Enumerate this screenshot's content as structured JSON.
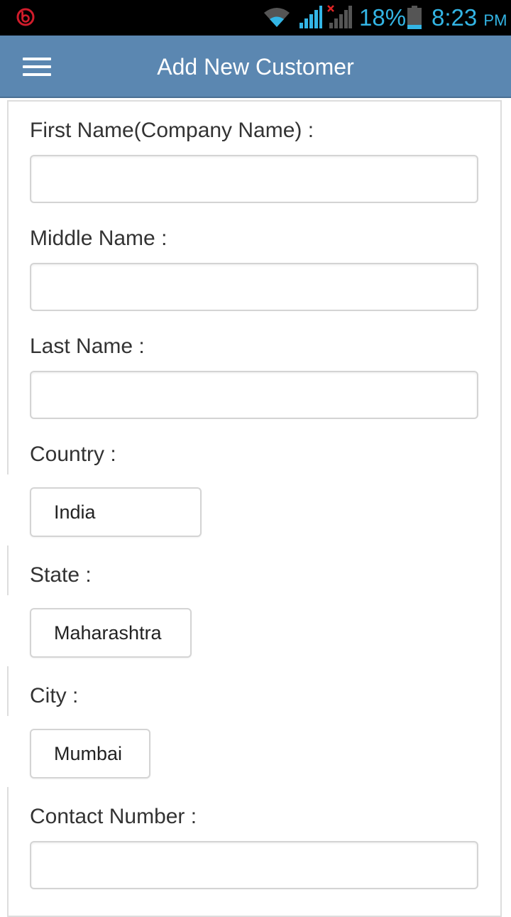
{
  "status_bar": {
    "battery_percent": "18%",
    "time": "8:23",
    "ampm": "PM",
    "accent_color": "#33b5e5"
  },
  "app_bar": {
    "title": "Add New Customer",
    "background_color": "#5b87b1"
  },
  "form": {
    "first_name_label": "First Name(Company Name) :",
    "middle_name_label": "Middle Name :",
    "last_name_label": "Last Name :",
    "country_label": "Country :",
    "country_value": "India",
    "state_label": "State :",
    "state_value": "Maharashtra",
    "city_label": "City :",
    "city_value": "Mumbai",
    "contact_label": "Contact Number :"
  },
  "icons": {
    "menu": "hamburger-menu-icon",
    "beats": "beats-logo-icon",
    "wifi": "wifi-icon",
    "signal": "cell-signal-icon",
    "battery": "battery-icon"
  }
}
